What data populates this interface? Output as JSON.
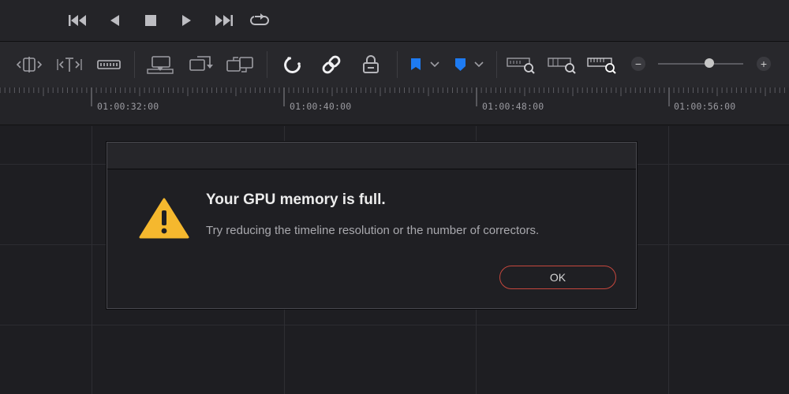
{
  "transport": {
    "buttons": [
      {
        "name": "go-to-start-icon"
      },
      {
        "name": "play-reverse-icon"
      },
      {
        "name": "stop-icon"
      },
      {
        "name": "play-icon"
      },
      {
        "name": "go-to-end-icon"
      },
      {
        "name": "loop-icon"
      }
    ]
  },
  "toolbar": {
    "tools": [
      "trim-edit-icon",
      "dynamic-trim-icon",
      "blade-icon",
      "insert-clip-icon",
      "overwrite-clip-icon",
      "replace-clip-icon",
      "snapping-icon",
      "linked-selection-icon",
      "position-lock-icon",
      "flag-icon",
      "marker-icon",
      "zoom-full-icon",
      "zoom-detail-icon",
      "zoom-custom-icon"
    ],
    "flag_color": "#1e7bf2",
    "marker_color": "#1e7bf2",
    "zoom_minus": "−",
    "zoom_plus": "+",
    "zoom_level": 0.6
  },
  "ruler": {
    "timecodes": [
      "01:00:32:00",
      "01:00:40:00",
      "01:00:48:00",
      "01:00:56:00"
    ]
  },
  "dialog": {
    "title": "Your GPU memory is full.",
    "message": "Try reducing the timeline resolution or the number of correctors.",
    "ok_label": "OK",
    "icon": "warning-icon",
    "warning_color": "#f5b82e",
    "accent_color": "#c6473d"
  }
}
